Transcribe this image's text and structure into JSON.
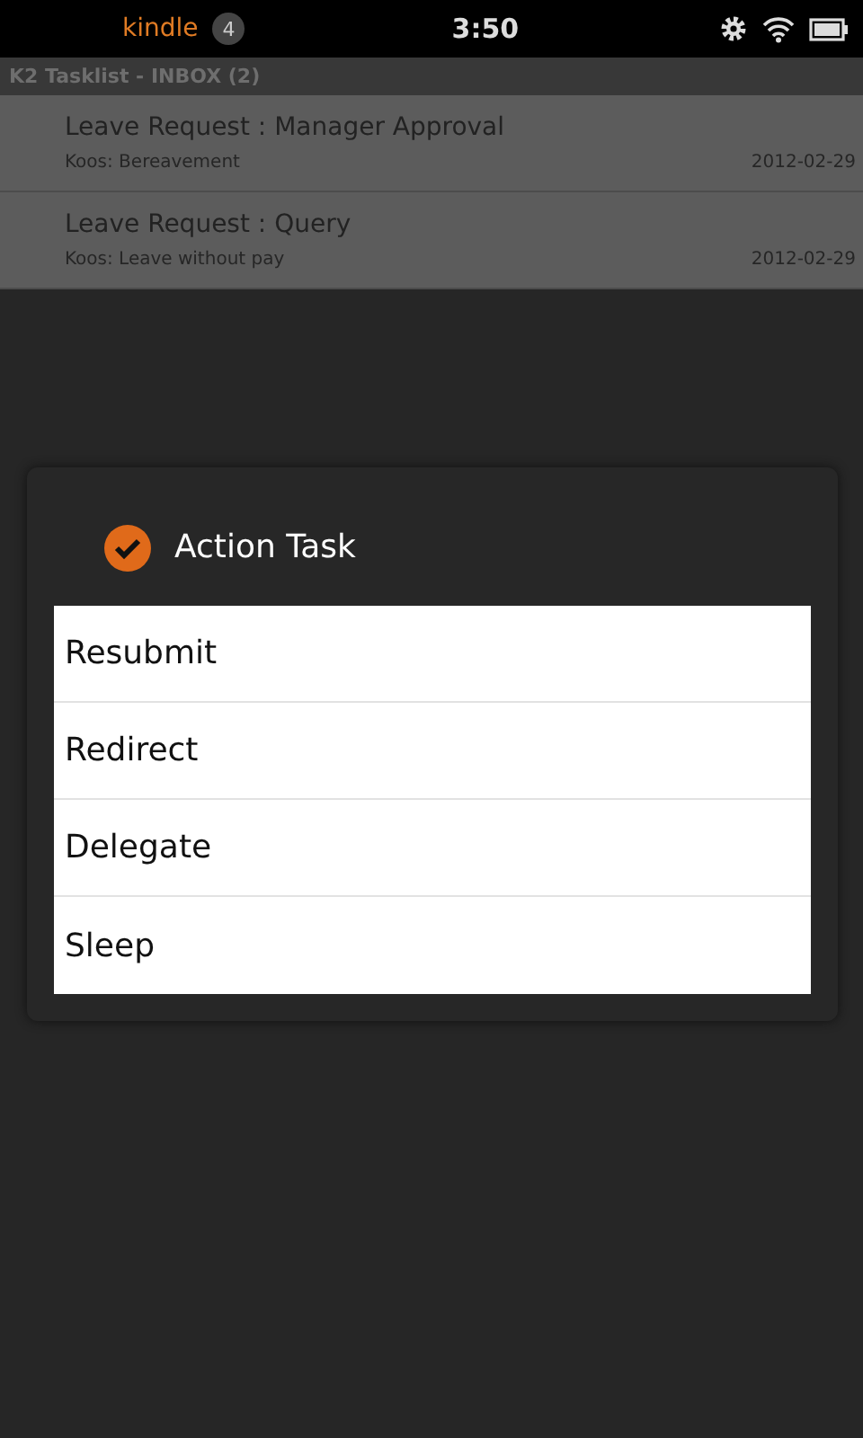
{
  "status_bar": {
    "app": "kindle",
    "notifications": "4",
    "time": "3:50"
  },
  "list_title": "K2 Tasklist - INBOX (2)",
  "tasks": [
    {
      "title": "Leave Request : Manager Approval",
      "subtitle": "Koos: Bereavement",
      "date": "2012-02-29"
    },
    {
      "title": "Leave Request : Query",
      "subtitle": "Koos: Leave without pay",
      "date": "2012-02-29"
    }
  ],
  "dialog": {
    "title": "Action Task",
    "options": [
      "Resubmit",
      "Redirect",
      "Delegate",
      "Sleep"
    ]
  }
}
